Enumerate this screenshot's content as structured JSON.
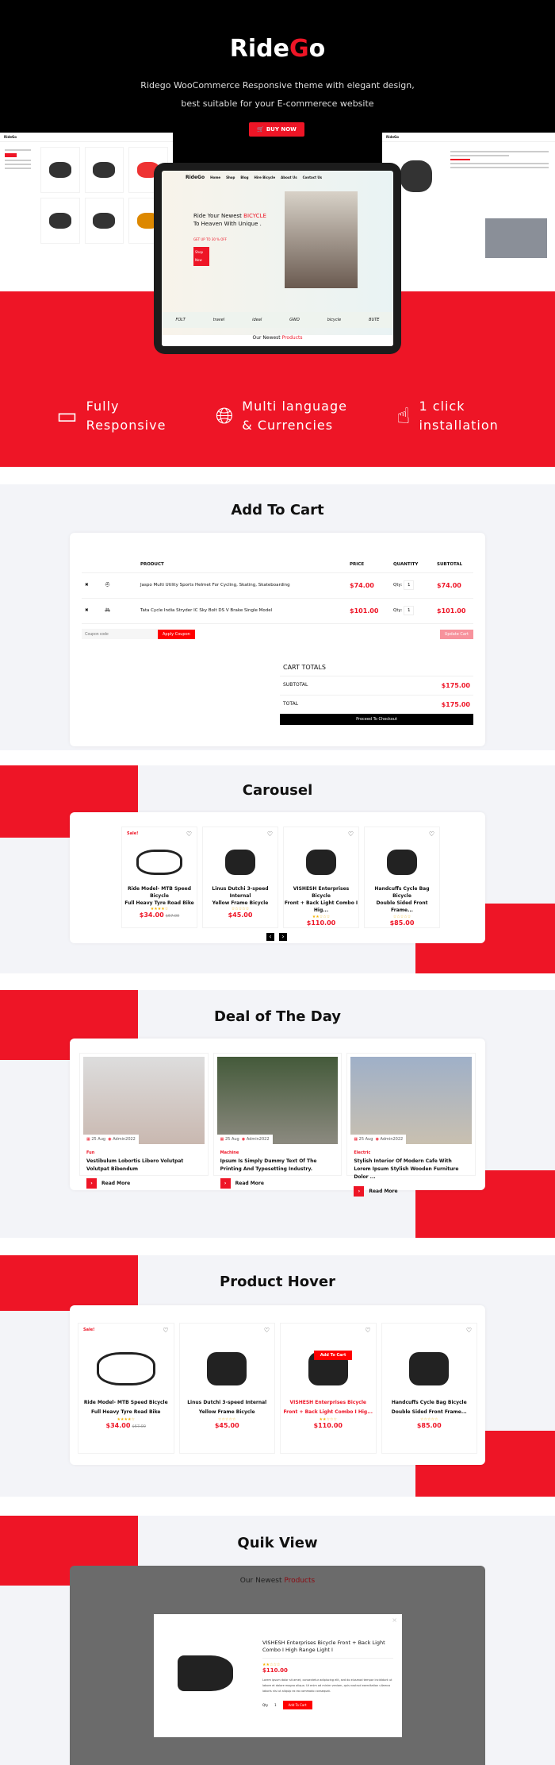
{
  "hero": {
    "logo": "RideGo",
    "logo_prefix": "Ride",
    "logo_g": "G",
    "logo_suffix": "o",
    "tagline_line1": "Ridego WooCommerce Responsive theme with elegant design,",
    "tagline_line2": "best suitable for your E-commerece website",
    "buy_label": "BUY NOW",
    "tablet": {
      "logo": "RideGo",
      "nav": [
        "Home",
        "Shop",
        "Blog",
        "Hire Bicycle",
        "About Us",
        "Contact Us"
      ],
      "headline_a": "Ride Your Newest",
      "headline_b": "BICYCLE",
      "headline_c": "To Heaven With Unique .",
      "offer": "GET UP TO 30 % OFF",
      "button": "Shop Now",
      "newest_a": "Our Newest",
      "newest_b": "Products",
      "brands": [
        "FOLT",
        "travel",
        "ideal",
        "GWD",
        "bicycle",
        "BUTE"
      ]
    }
  },
  "features": [
    {
      "icon": "devices-icon",
      "line1": "Fully",
      "line2": "Responsive"
    },
    {
      "icon": "globe-icon",
      "line1": "Multi language",
      "line2": "& Currencies"
    },
    {
      "icon": "tap-icon",
      "line1": "1 click",
      "line2": "installation"
    }
  ],
  "cart": {
    "title": "Add To Cart",
    "headers": [
      "PRODUCT",
      "PRICE",
      "QUANTITY",
      "SUBTOTAL"
    ],
    "rows": [
      {
        "name": "Jaspo Multi Utility Sports Helmet For Cycling, Skating, Skateboarding",
        "price": "$74.00",
        "qty_label": "Qty:",
        "qty": "1",
        "subtotal": "$74.00"
      },
      {
        "name": "Tata Cycle India Stryder IC Sky Bolt DS V Brake Single Model",
        "price": "$101.00",
        "qty_label": "Qty:",
        "qty": "1",
        "subtotal": "$101.00"
      }
    ],
    "coupon_placeholder": "Coupon code",
    "apply": "Apply Coupon",
    "update": "Update Cart",
    "totals_title": "CART TOTALS",
    "subtotal_label": "SUBTOTAL",
    "subtotal": "$175.00",
    "total_label": "TOTAL",
    "total": "$175.00",
    "checkout": "Proceed To Checkout"
  },
  "products": [
    {
      "name1": "Ride Model- MTB Speed Bicycle",
      "name2": "Full Heavy Tyre Road Bike",
      "price": "$34.00",
      "old": "$67.00",
      "sale": "Sale!",
      "rating": 4
    },
    {
      "name1": "Linus Dutchi 3-speed Internal",
      "name2": "Yellow Frame Bicycle",
      "price": "$45.00",
      "old": "",
      "sale": "",
      "rating": 0
    },
    {
      "name1": "VISHESH Enterprises Bicycle",
      "name2": "Front + Back Light Combo I Hig...",
      "price": "$110.00",
      "old": "",
      "sale": "",
      "rating": 2
    },
    {
      "name1": "Handcuffs Cycle Bag Bicycle",
      "name2": "Double Sided Front Frame...",
      "price": "$85.00",
      "old": "",
      "sale": "",
      "rating": 0
    }
  ],
  "carousel": {
    "title": "Carousel",
    "prev": "‹",
    "next": "›"
  },
  "deal": {
    "title": "Deal of The Day",
    "posts": [
      {
        "date": "25 Aug",
        "author": "Admin2022",
        "category": "Fun",
        "title": "Vestibulum Lobortis Libero Volutpat Volutpat Bibendum",
        "read": "Read More"
      },
      {
        "date": "25 Aug",
        "author": "Admin2022",
        "category": "Machine",
        "title": "Ipsum Is Simply Dummy Text Of The Printing And Typesetting Industry.",
        "read": "Read More"
      },
      {
        "date": "25 Aug",
        "author": "Admin2022",
        "category": "Electric",
        "title": "Stylish Interior Of Modern Cafe With Lorem Ipsum Stylish Wooden Furniture Dolor ...",
        "read": "Read More"
      }
    ]
  },
  "hover": {
    "title": "Product Hover",
    "add_to_cart": "Add To Cart"
  },
  "quick": {
    "title": "Quik View",
    "bg_a": "Our Newest",
    "bg_b": "Products",
    "product": "VISHESH Enterprises Bicycle Front + Back Light Combo I High Range Light I",
    "price": "$110.00",
    "rating": 2,
    "desc": "Lorem ipsum dolor sit amet, consectetur adipiscing elit, sed do eiusmod tempor incididunt ut labore et dolore magna aliqua. Ut enim ad minim veniam, quis nostrud exercitation ullamco laboris nisi ut aliquip ex ea commodo consequat.",
    "qty_label": "Qty",
    "qty": "1",
    "add": "Add To Cart",
    "close": "×"
  },
  "colors": {
    "accent": "#ee1526",
    "dark": "#000000",
    "section_bg": "#f3f4f8"
  }
}
